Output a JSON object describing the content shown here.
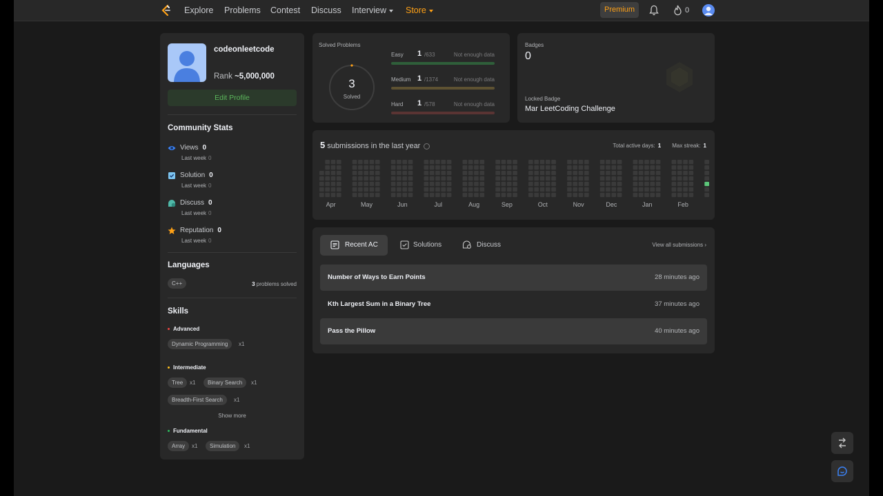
{
  "nav": {
    "links": [
      "Explore",
      "Problems",
      "Contest",
      "Discuss",
      "Interview",
      "Store"
    ],
    "premium": "Premium",
    "fire_count": "0"
  },
  "profile": {
    "username": "codeonleetcode",
    "rank_label": "Rank",
    "rank_value": "~5,000,000",
    "edit_label": "Edit Profile"
  },
  "community": {
    "title": "Community Stats",
    "stats": [
      {
        "label": "Views",
        "value": "0",
        "sub_label": "Last week",
        "sub_value": "0",
        "icon": "eye-icon"
      },
      {
        "label": "Solution",
        "value": "0",
        "sub_label": "Last week",
        "sub_value": "0",
        "icon": "check-square-icon"
      },
      {
        "label": "Discuss",
        "value": "0",
        "sub_label": "Last week",
        "sub_value": "0",
        "icon": "chat-bubble-icon"
      },
      {
        "label": "Reputation",
        "value": "0",
        "sub_label": "Last week",
        "sub_value": "0",
        "icon": "star-icon"
      }
    ]
  },
  "languages": {
    "title": "Languages",
    "items": [
      {
        "name": "C++",
        "count": "3",
        "suffix": "problems solved"
      }
    ]
  },
  "skills": {
    "title": "Skills",
    "advanced": {
      "label": "Advanced",
      "items": [
        {
          "name": "Dynamic Programming",
          "count": "x1"
        }
      ]
    },
    "intermediate": {
      "label": "Intermediate",
      "items": [
        {
          "name": "Tree",
          "count": "x1"
        },
        {
          "name": "Binary Search",
          "count": "x1"
        },
        {
          "name": "Breadth-First Search",
          "count": "x1"
        }
      ]
    },
    "show_more": "Show more",
    "fundamental": {
      "label": "Fundamental",
      "items": [
        {
          "name": "Array",
          "count": "x1"
        },
        {
          "name": "Simulation",
          "count": "x1"
        }
      ]
    }
  },
  "solved": {
    "title": "Solved Problems",
    "total": "3",
    "word": "Solved",
    "difficulties": [
      {
        "name": "Easy",
        "count": "1",
        "total": "/633",
        "note": "Not enough data",
        "color": "#2cbb5d"
      },
      {
        "name": "Medium",
        "count": "1",
        "total": "/1374",
        "note": "Not enough data",
        "color": "#ffc01e"
      },
      {
        "name": "Hard",
        "count": "1",
        "total": "/578",
        "note": "Not enough data",
        "color": "#ef4743"
      }
    ]
  },
  "badges": {
    "title": "Badges",
    "count": "0",
    "locked_label": "Locked Badge",
    "locked_name": "Mar LeetCoding Challenge"
  },
  "submissions": {
    "count": "5",
    "text": "submissions in the last year",
    "active_label": "Total active days:",
    "active_value": "1",
    "streak_label": "Max streak:",
    "streak_value": "1",
    "months": [
      "Apr",
      "May",
      "Jun",
      "Jul",
      "Aug",
      "Sep",
      "Oct",
      "Nov",
      "Dec",
      "Jan",
      "Feb"
    ]
  },
  "recent": {
    "tabs": [
      "Recent AC",
      "Solutions",
      "Discuss"
    ],
    "view_all": "View all submissions",
    "items": [
      {
        "title": "Number of Ways to Earn Points",
        "time": "28 minutes ago"
      },
      {
        "title": "Kth Largest Sum in a Binary Tree",
        "time": "37 minutes ago"
      },
      {
        "title": "Pass the Pillow",
        "time": "40 minutes ago"
      }
    ]
  },
  "colors": {
    "accent": "#ffa116",
    "easy": "#2cbb5d",
    "medium": "#ffc01e",
    "hard": "#ef4743",
    "active_cell": "#5cc77a"
  }
}
